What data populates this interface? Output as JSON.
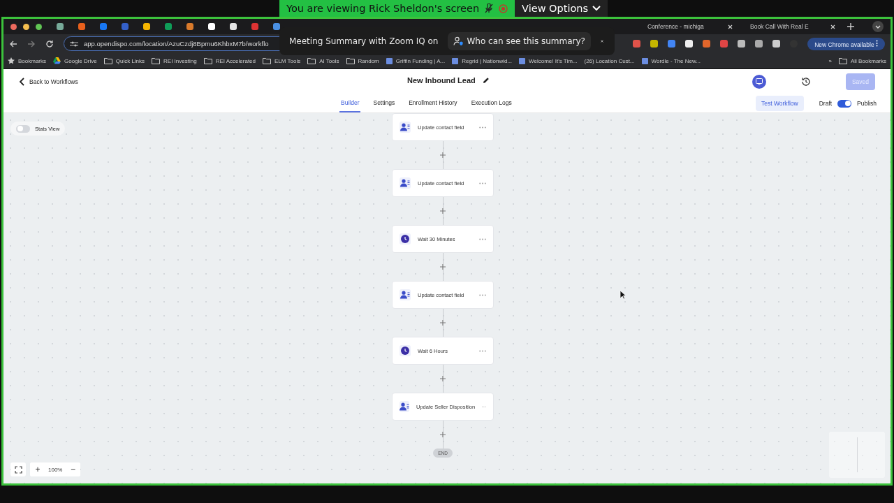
{
  "share_banner": {
    "text": "You are viewing Rick Sheldon's screen",
    "view_options": "View Options"
  },
  "summary_popup": {
    "title": "Meeting Summary with Zoom IQ on",
    "button": "Who can see this summary?"
  },
  "browser": {
    "tabs": [
      {
        "label": "Conference - michiga"
      },
      {
        "label": "Book Call With Real E"
      }
    ],
    "address": "app.opendispo.com/location/AzuCzdj8Bpmu6KhbxM7b/workflo",
    "update_button": "New Chrome available",
    "bookmarks": [
      {
        "label": "Bookmarks",
        "kind": "star"
      },
      {
        "label": "Google Drive",
        "kind": "drive"
      },
      {
        "label": "Quick Links",
        "kind": "folder"
      },
      {
        "label": "REI Investing",
        "kind": "folder"
      },
      {
        "label": "REI Accelerated",
        "kind": "folder"
      },
      {
        "label": "ELM Tools",
        "kind": "folder"
      },
      {
        "label": "AI Tools",
        "kind": "folder"
      },
      {
        "label": "Random",
        "kind": "folder"
      },
      {
        "label": "Griffin Funding | A...",
        "kind": "page"
      },
      {
        "label": "Regrid | Nationwid...",
        "kind": "page"
      },
      {
        "label": "Welcome! It's Tim...",
        "kind": "page"
      },
      {
        "label": "(26) Location Cust...",
        "kind": "none"
      },
      {
        "label": "Wordle - The New...",
        "kind": "page"
      }
    ],
    "more_bookmarks": "»",
    "all_bookmarks": "All Bookmarks"
  },
  "header": {
    "back": "Back to Workflows",
    "title": "New Inbound Lead",
    "saved": {
      "label": "Saved",
      "disabled": true
    },
    "tabs": [
      {
        "label": "Builder",
        "selected": true
      },
      {
        "label": "Settings",
        "selected": false
      },
      {
        "label": "Enrollment History",
        "selected": false
      },
      {
        "label": "Execution Logs",
        "selected": false
      }
    ],
    "test_button": "Test Workflow",
    "draft_label": "Draft",
    "publish": {
      "label": "Publish",
      "on": true
    }
  },
  "stats_view": {
    "label": "Stats View",
    "on": false
  },
  "steps": [
    {
      "label": "Update contact field",
      "kind": "action"
    },
    {
      "label": "Update contact field",
      "kind": "action"
    },
    {
      "label": "Wait 30 Minutes",
      "kind": "wait"
    },
    {
      "label": "Update contact field",
      "kind": "action"
    },
    {
      "label": "Wait 6 Hours",
      "kind": "wait"
    },
    {
      "label": "Update Seller Disposition",
      "kind": "action"
    }
  ],
  "end_label": "END",
  "zoom": {
    "level_text": "100%",
    "plus": "+",
    "minus": "−"
  }
}
